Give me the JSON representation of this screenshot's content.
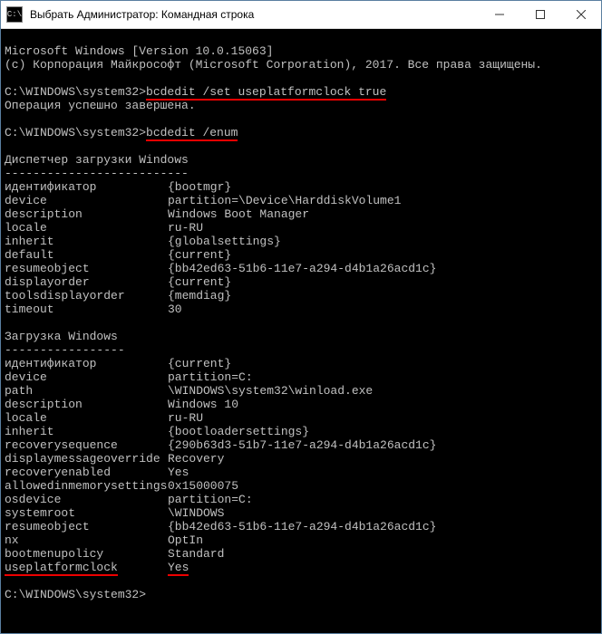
{
  "window": {
    "title": "Выбрать Администратор: Командная строка",
    "icon_glyph": "C:\\"
  },
  "terminal": {
    "header_line1": "Microsoft Windows [Version 10.0.15063]",
    "header_line2": "(c) Корпорация Майкрософт (Microsoft Corporation), 2017. Все права защищены.",
    "prompt1": "C:\\WINDOWS\\system32>",
    "cmd1": "bcdedit /set useplatformclock true",
    "result1": "Операция успешно завершена.",
    "prompt2": "C:\\WINDOWS\\system32>",
    "cmd2": "bcdedit /enum",
    "section1_title": "Диспетчер загрузки Windows",
    "section1_rule": "--------------------------",
    "section1_rows": [
      {
        "key": "идентификатор",
        "val": "{bootmgr}"
      },
      {
        "key": "device",
        "val": "partition=\\Device\\HarddiskVolume1"
      },
      {
        "key": "description",
        "val": "Windows Boot Manager"
      },
      {
        "key": "locale",
        "val": "ru-RU"
      },
      {
        "key": "inherit",
        "val": "{globalsettings}"
      },
      {
        "key": "default",
        "val": "{current}"
      },
      {
        "key": "resumeobject",
        "val": "{bb42ed63-51b6-11e7-a294-d4b1a26acd1c}"
      },
      {
        "key": "displayorder",
        "val": "{current}"
      },
      {
        "key": "toolsdisplayorder",
        "val": "{memdiag}"
      },
      {
        "key": "timeout",
        "val": "30"
      }
    ],
    "section2_title": "Загрузка Windows",
    "section2_rule": "-----------------",
    "section2_rows": [
      {
        "key": "идентификатор",
        "val": "{current}"
      },
      {
        "key": "device",
        "val": "partition=C:"
      },
      {
        "key": "path",
        "val": "\\WINDOWS\\system32\\winload.exe"
      },
      {
        "key": "description",
        "val": "Windows 10"
      },
      {
        "key": "locale",
        "val": "ru-RU"
      },
      {
        "key": "inherit",
        "val": "{bootloadersettings}"
      },
      {
        "key": "recoverysequence",
        "val": "{290b63d3-51b7-11e7-a294-d4b1a26acd1c}"
      },
      {
        "key": "displaymessageoverride",
        "val": "Recovery"
      },
      {
        "key": "recoveryenabled",
        "val": "Yes"
      },
      {
        "key": "allowedinmemorysettings",
        "val": "0x15000075"
      },
      {
        "key": "osdevice",
        "val": "partition=C:"
      },
      {
        "key": "systemroot",
        "val": "\\WINDOWS"
      },
      {
        "key": "resumeobject",
        "val": "{bb42ed63-51b6-11e7-a294-d4b1a26acd1c}"
      },
      {
        "key": "nx",
        "val": "OptIn"
      },
      {
        "key": "bootmenupolicy",
        "val": "Standard"
      },
      {
        "key": "useplatformclock",
        "val": "Yes",
        "underline_key": true,
        "underline_val": true
      }
    ],
    "prompt3": "C:\\WINDOWS\\system32>"
  }
}
